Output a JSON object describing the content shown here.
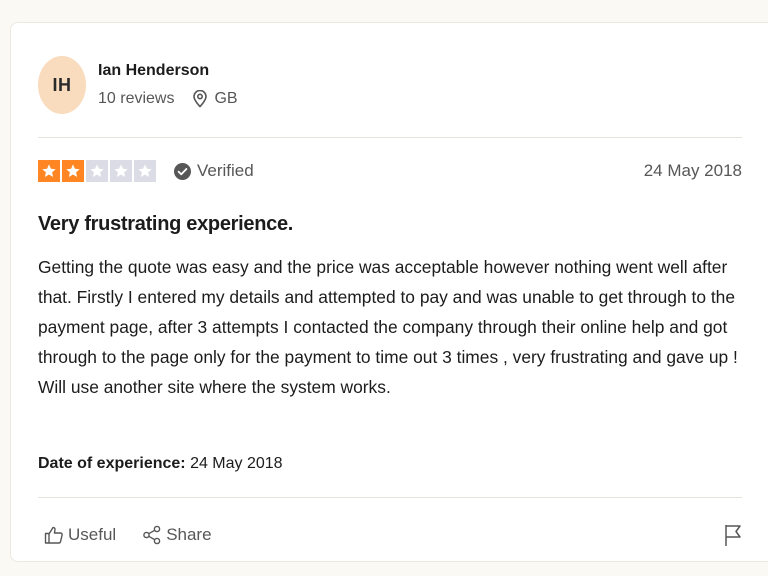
{
  "reviewer": {
    "initials": "IH",
    "name": "Ian Henderson",
    "reviews_count": "10 reviews",
    "country": "GB"
  },
  "rating": {
    "stars": 2,
    "max_stars": 5,
    "filled_color": "#ff8622",
    "empty_color": "#dcdce6",
    "verified_label": "Verified",
    "date": "24 May 2018"
  },
  "review": {
    "title": "Very frustrating experience.",
    "body_lines": [
      "Getting the quote was easy and the price was acceptable however nothing went well after that. Firstly I entered my details and attempted to pay and was unable to get through to the payment page, after 3 attempts I contacted the company through their online help and got through to the page only for the payment to time out 3 times , very frustrating and gave up !",
      "Will use another site where the system works."
    ]
  },
  "experience": {
    "label": "Date of experience:",
    "value": "24 May 2018"
  },
  "actions": {
    "useful_label": "Useful",
    "share_label": "Share"
  },
  "icons": {
    "location": "location-pin-icon",
    "verified": "check-circle-icon",
    "useful": "thumbs-up-icon",
    "share": "share-icon",
    "report": "flag-icon",
    "star": "star-icon"
  }
}
